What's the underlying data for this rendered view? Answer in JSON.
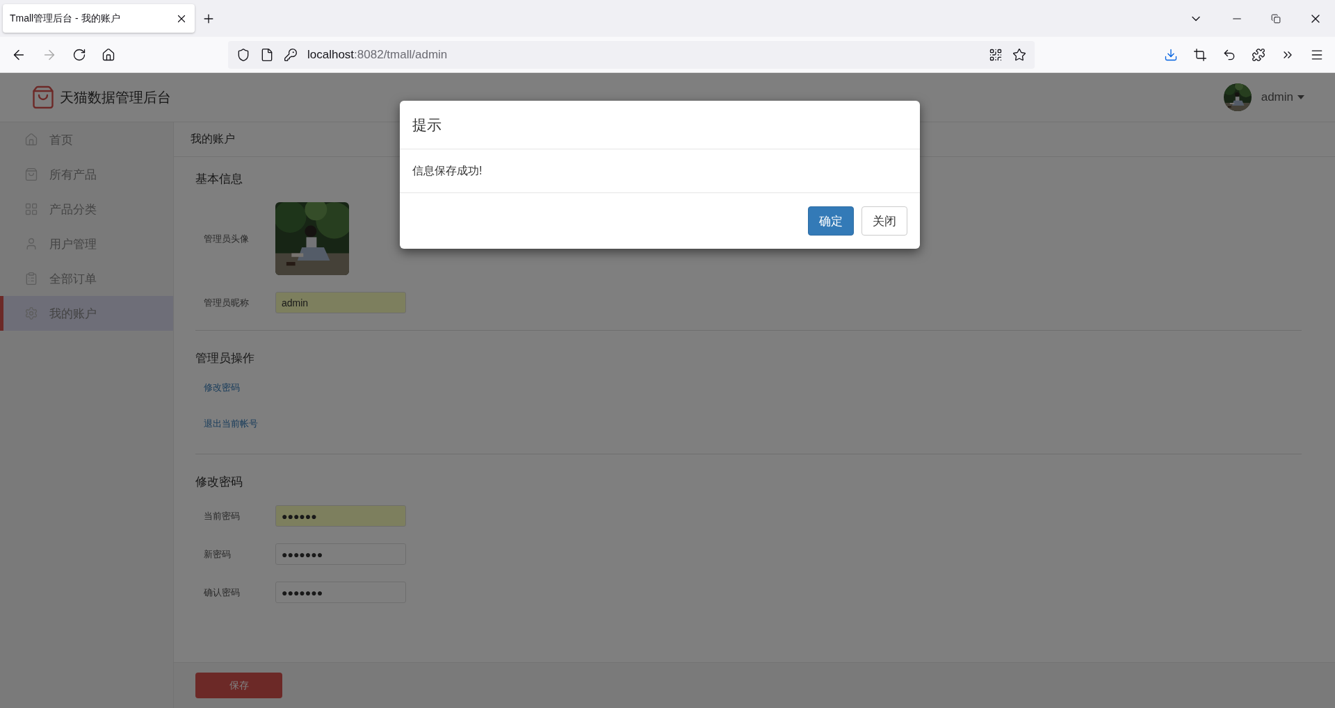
{
  "browser": {
    "tab": {
      "title": "Tmall管理后台 - 我的账户"
    },
    "url": {
      "host": "localhost",
      "path": ":8082/tmall/admin"
    }
  },
  "header": {
    "brand": "天猫数据管理后台",
    "user": {
      "name": "admin"
    }
  },
  "sidebar": {
    "items": [
      {
        "label": "首页",
        "selected": false
      },
      {
        "label": "所有产品",
        "selected": false
      },
      {
        "label": "产品分类",
        "selected": false
      },
      {
        "label": "用户管理",
        "selected": false
      },
      {
        "label": "全部订单",
        "selected": false
      },
      {
        "label": "我的账户",
        "selected": true
      }
    ]
  },
  "breadcrumb": "我的账户",
  "basic_info": {
    "heading": "基本信息",
    "avatar_label": "管理员头像",
    "nickname": {
      "label": "管理员昵称",
      "value": "admin",
      "autofilled": true
    }
  },
  "operations": {
    "heading": "管理员操作",
    "links": [
      "修改密码",
      "退出当前帐号"
    ]
  },
  "password": {
    "heading": "修改密码",
    "fields": [
      {
        "label": "当前密码",
        "value": "●●●●●●",
        "autofilled": true
      },
      {
        "label": "新密码",
        "value": "●●●●●●●",
        "autofilled": false
      },
      {
        "label": "确认密码",
        "value": "●●●●●●●",
        "autofilled": false
      }
    ]
  },
  "save_button": "保存",
  "dialog": {
    "title": "提示",
    "message": "信息保存成功!",
    "buttons": [
      {
        "label": "确定",
        "kind": "primary"
      },
      {
        "label": "关闭",
        "kind": "default"
      }
    ]
  }
}
